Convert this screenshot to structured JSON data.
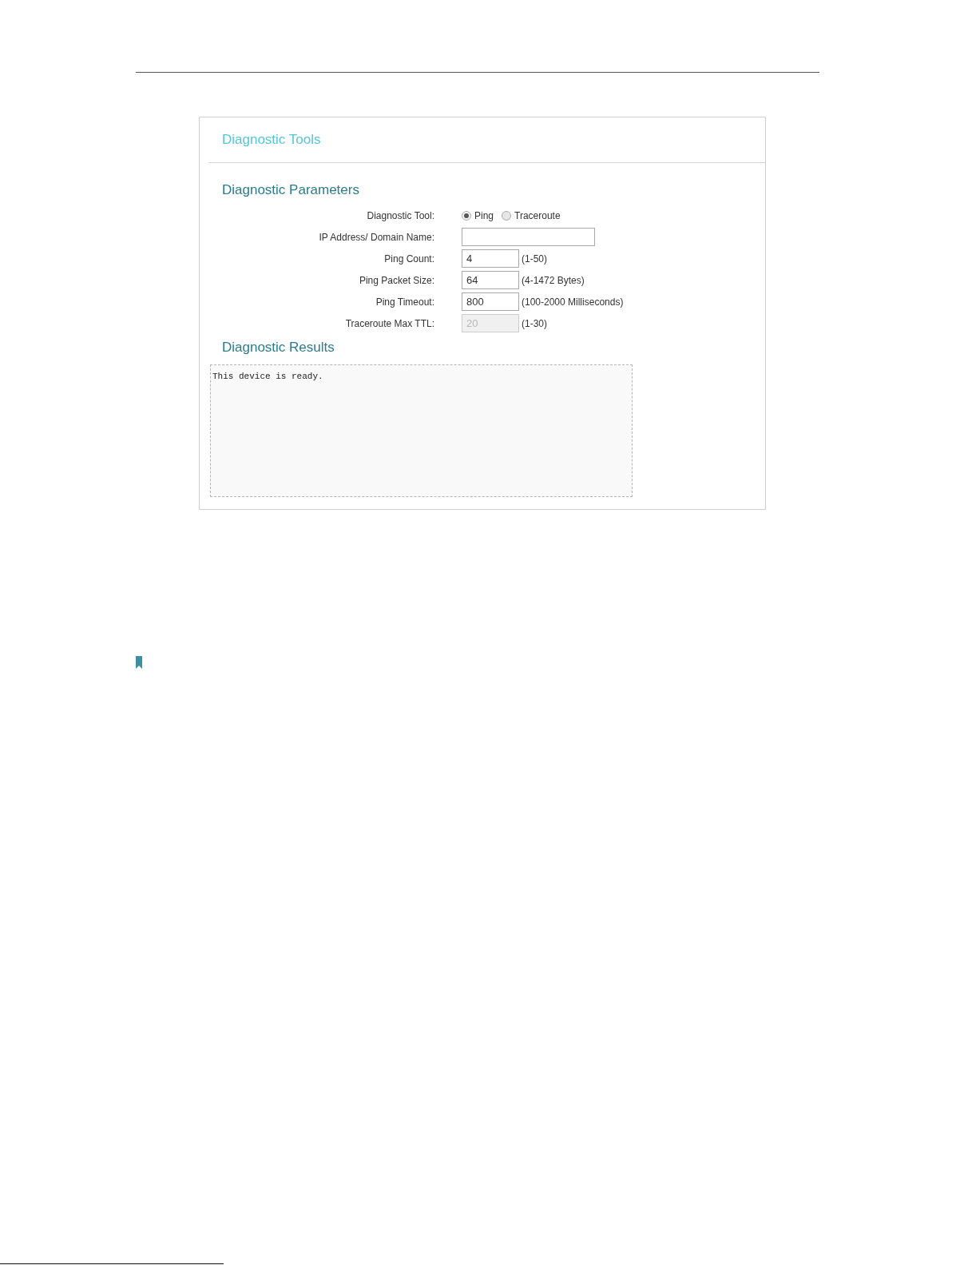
{
  "panel": {
    "title": "Diagnostic Tools"
  },
  "parameters": {
    "heading": "Diagnostic Parameters",
    "fields": [
      {
        "kind": "radio",
        "label": "Diagnostic Tool:",
        "options": [
          {
            "label": "Ping",
            "selected": true
          },
          {
            "label": "Traceroute",
            "selected": false
          }
        ]
      },
      {
        "kind": "wide",
        "label": "IP Address/ Domain Name:",
        "disabled": false
      },
      {
        "kind": "short",
        "label": "Ping Count:",
        "value": "4",
        "hint": "(1-50)",
        "disabled": false
      },
      {
        "kind": "short",
        "label": "Ping Packet Size:",
        "value": "64",
        "hint": "(4-1472 Bytes)",
        "disabled": false
      },
      {
        "kind": "short",
        "label": "Ping Timeout:",
        "value": "800",
        "hint": "(100-2000 Milliseconds)",
        "disabled": false
      },
      {
        "kind": "short",
        "label": "Traceroute Max TTL:",
        "value": "20",
        "hint": "(1-30)",
        "disabled": true
      }
    ]
  },
  "results": {
    "heading": "Diagnostic Results",
    "output": "This device is ready."
  }
}
